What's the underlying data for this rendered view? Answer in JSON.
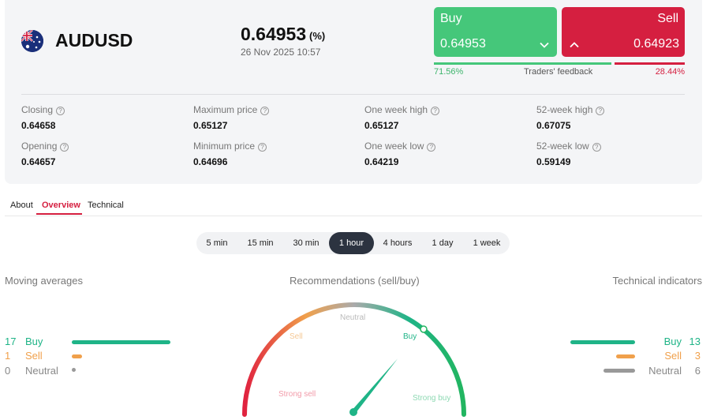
{
  "header": {
    "symbol": "AUDUSD",
    "flag_icon": "australia-flag-icon",
    "price": "0.64953",
    "change_pct": "(%)",
    "datetime": "26 Nov 2025 10:57"
  },
  "trade": {
    "buy_label": "Buy",
    "buy_price": "0.64953",
    "sell_label": "Sell",
    "sell_price": "0.64923",
    "buy_color": "#45c77a",
    "sell_color": "#d51f40"
  },
  "feedback": {
    "label": "Traders' feedback",
    "buy_pct": "71.56%",
    "sell_pct": "28.44%",
    "buy_share": 0.7156
  },
  "stats": [
    {
      "label": "Closing",
      "value": "0.64658"
    },
    {
      "label": "Maximum price",
      "value": "0.65127"
    },
    {
      "label": "One week high",
      "value": "0.65127"
    },
    {
      "label": "52-week high",
      "value": "0.67075"
    },
    {
      "label": "Opening",
      "value": "0.64657"
    },
    {
      "label": "Minimum price",
      "value": "0.64696"
    },
    {
      "label": "One week low",
      "value": "0.64219"
    },
    {
      "label": "52-week low",
      "value": "0.59149"
    }
  ],
  "tabs": [
    {
      "label": "About"
    },
    {
      "label": "Overview",
      "active": true
    },
    {
      "label": "Technical"
    }
  ],
  "timeframes": [
    {
      "label": "5 min"
    },
    {
      "label": "15 min"
    },
    {
      "label": "30 min"
    },
    {
      "label": "1 hour",
      "active": true
    },
    {
      "label": "4 hours"
    },
    {
      "label": "1 day"
    },
    {
      "label": "1 week"
    }
  ],
  "moving_averages": {
    "title": "Moving averages",
    "buy": {
      "count": "17",
      "label": "Buy"
    },
    "sell": {
      "count": "1",
      "label": "Sell"
    },
    "neutral": {
      "count": "0",
      "label": "Neutral"
    }
  },
  "recommendations": {
    "title": "Recommendations (sell/buy)",
    "labels": {
      "strong_sell": "Strong sell",
      "sell": "Sell",
      "neutral": "Neutral",
      "buy": "Buy",
      "strong_buy": "Strong buy"
    },
    "needle_value": 0.72
  },
  "technical_indicators": {
    "title": "Technical indicators",
    "buy": {
      "count": "13",
      "label": "Buy"
    },
    "sell": {
      "count": "3",
      "label": "Sell"
    },
    "neutral": {
      "count": "6",
      "label": "Neutral"
    }
  },
  "colors": {
    "buy": "#1fb487",
    "sell": "#f0a04b",
    "neutral": "#999999",
    "accent": "#d51f40"
  }
}
